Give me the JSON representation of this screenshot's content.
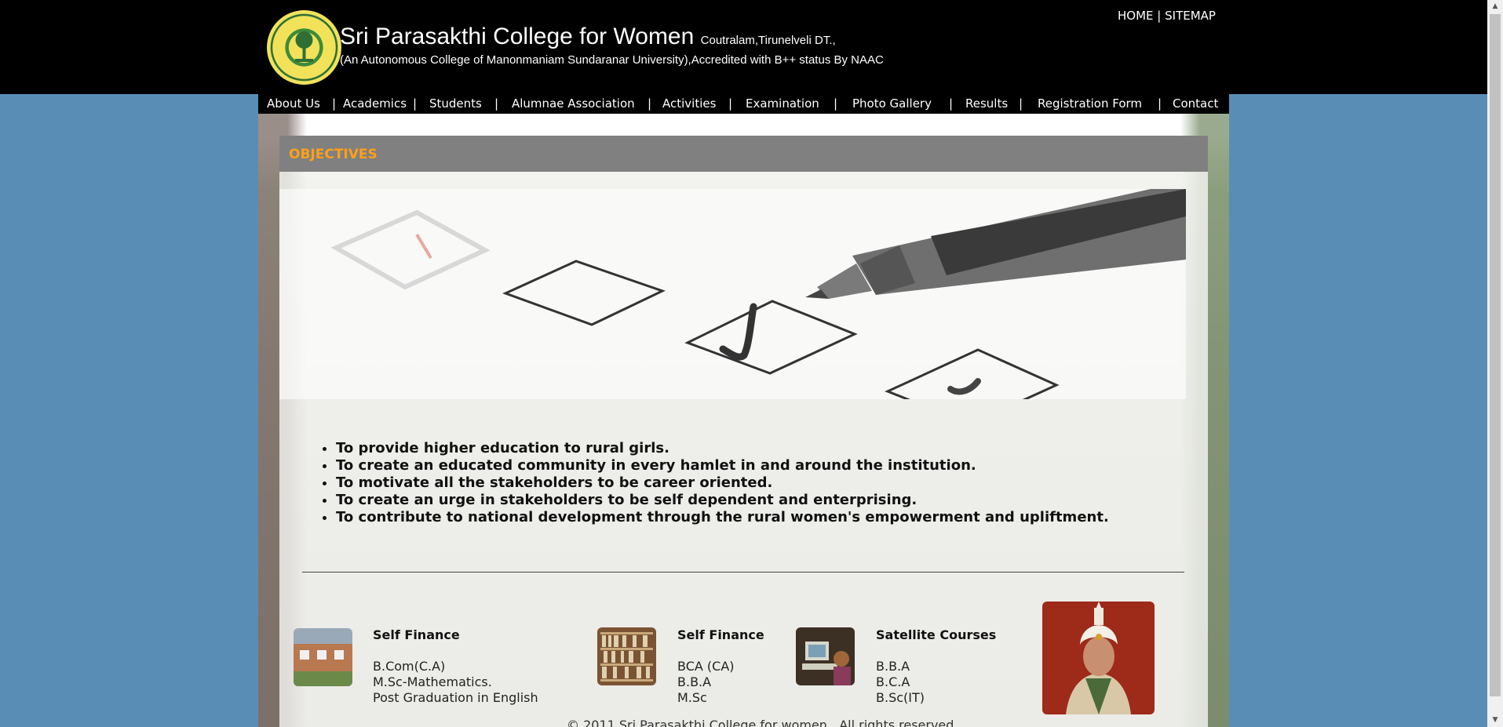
{
  "header": {
    "college_name": "Sri Parasakthi College for Women",
    "college_place": "Coutralam,Tirunelveli DT.,",
    "subtitle": "(An Autonomous College of Manonmaniam Sundaranar University),Accredited with B++ status By NAAC",
    "top_links": {
      "home": "HOME",
      "separator": "|",
      "sitemap": "SITEMAP"
    }
  },
  "nav": {
    "items": [
      "About Us",
      "Academics",
      "Students",
      "Alumnae Association",
      "Activities",
      "Examination",
      "Photo Gallery",
      "Results",
      "Registration Form",
      "Contact"
    ],
    "separator": "|"
  },
  "objectives": {
    "title": "OBJECTIVES",
    "items": [
      "To provide higher education to rural girls.",
      "To create an educated community in every hamlet in and around the institution.",
      "To motivate all the stakeholders to be career oriented.",
      "To create an urge in stakeholders to be self dependent and enterprising.",
      "To contribute to national development through the rural women's empowerment and upliftment."
    ]
  },
  "courses": [
    {
      "title": "Self Finance",
      "lines": [
        "B.Com(C.A)",
        "M.Sc-Mathematics.",
        "Post Graduation in English"
      ]
    },
    {
      "title": "Self Finance",
      "lines": [
        "BCA (CA)",
        "B.B.A",
        "M.Sc"
      ]
    },
    {
      "title": "Satellite Courses",
      "lines": [
        "B.B.A",
        "B.C.A",
        "B.Sc(IT)"
      ]
    }
  ],
  "footer": {
    "copyright": "© 2011 Sri Parasakthi College for women . All rights reserved."
  },
  "colors": {
    "header_bg": "#000000",
    "page_bg": "#5a8db5",
    "objectives_title": "#ffa019",
    "objectives_bar": "#808080"
  }
}
